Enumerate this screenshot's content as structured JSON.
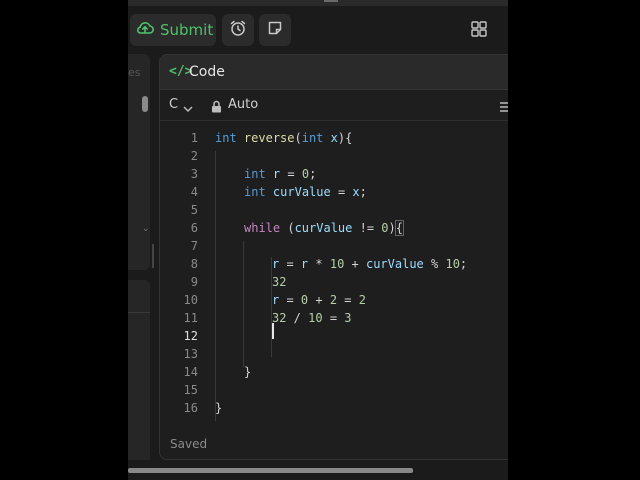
{
  "toolbar": {
    "submit_label": "Submit",
    "icons": [
      "upload-cloud-icon",
      "alarm-clock-icon",
      "note-icon",
      "layout-grid-icon"
    ]
  },
  "left_panel": {
    "partial_text": "es"
  },
  "code_panel": {
    "title": "Code",
    "language": "C",
    "mode": "Auto",
    "status": "Saved"
  },
  "editor": {
    "active_line": 12,
    "lines": [
      {
        "num": "1",
        "text": "int reverse(int x){"
      },
      {
        "num": "2",
        "text": ""
      },
      {
        "num": "3",
        "text": "int r = 0;"
      },
      {
        "num": "4",
        "text": "int curValue = x;"
      },
      {
        "num": "5",
        "text": ""
      },
      {
        "num": "6",
        "text": "while (curValue != 0){"
      },
      {
        "num": "7",
        "text": ""
      },
      {
        "num": "8",
        "text": "r = r * 10 + curValue % 10;"
      },
      {
        "num": "9",
        "text": "32"
      },
      {
        "num": "10",
        "text": "r = 0 + 2 = 2"
      },
      {
        "num": "11",
        "text": "32 / 10 = 3"
      },
      {
        "num": "12",
        "text": ""
      },
      {
        "num": "13",
        "text": ""
      },
      {
        "num": "14",
        "text": "}"
      },
      {
        "num": "15",
        "text": ""
      },
      {
        "num": "16",
        "text": "}"
      }
    ]
  }
}
